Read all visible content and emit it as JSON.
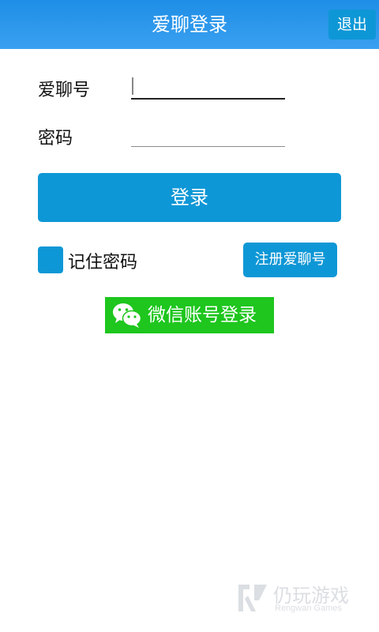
{
  "header": {
    "title": "爱聊登录",
    "exit_label": "退出"
  },
  "form": {
    "account_label": "爱聊号",
    "account_value": "",
    "password_label": "密码",
    "password_value": ""
  },
  "login_button_label": "登录",
  "remember": {
    "label": "记住密码",
    "checked": true
  },
  "register_label": "注册爱聊号",
  "wechat_login_label": "微信账号登录",
  "watermark": {
    "brand_cn": "仍玩游戏",
    "brand_en": "Rengwan Games"
  },
  "colors": {
    "header": "#2a96ec",
    "accent": "#0e97d6",
    "wechat": "#1ec61e"
  }
}
